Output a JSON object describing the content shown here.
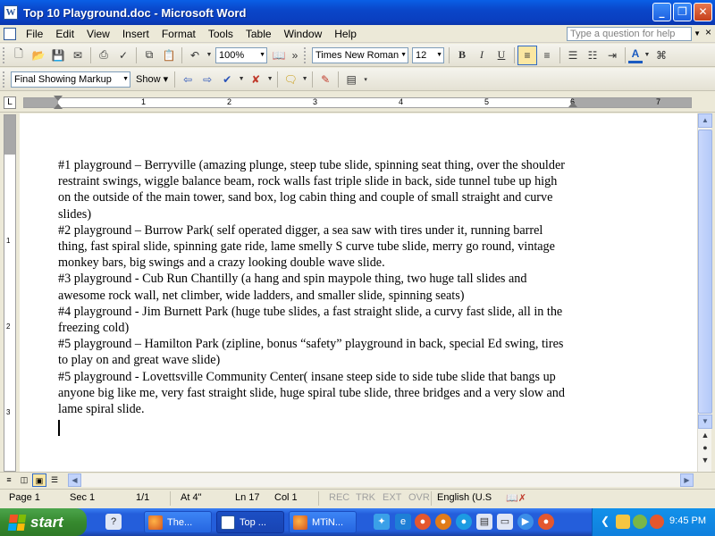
{
  "window": {
    "title": "Top 10 Playground.doc - Microsoft Word",
    "app_icon": "word-doc-icon",
    "buttons": {
      "minimize": "_",
      "restore": "❐",
      "close": "✕"
    }
  },
  "menubar": {
    "items": [
      "File",
      "Edit",
      "View",
      "Insert",
      "Format",
      "Tools",
      "Table",
      "Window",
      "Help"
    ],
    "ask_placeholder": "Type a question for help",
    "close_glyph": "×"
  },
  "toolbar": {
    "zoom": "100%",
    "font_name": "Times New Roman",
    "font_size": "12",
    "bold": "B",
    "italic": "I",
    "underline": "U"
  },
  "reviewing": {
    "display_mode": "Final Showing Markup",
    "show_label": "Show"
  },
  "ruler": {
    "numbers": [
      "1",
      "2",
      "3",
      "4",
      "5",
      "6",
      "7"
    ],
    "vertical_numbers": [
      "1",
      "2",
      "3"
    ]
  },
  "document": {
    "paragraphs": [
      "#1 playground – Berryville (amazing plunge, steep tube slide, spinning seat thing, over the shoulder restraint swings, wiggle balance beam, rock walls fast triple slide in back, side tunnel tube up high on the outside of the main tower, sand box, log cabin thing and couple of small straight and curve slides)",
      "#2 playground – Burrow Park( self operated digger, a sea saw with tires under it, running barrel thing, fast spiral slide, spinning gate ride, lame smelly S curve tube slide, merry go round, vintage monkey bars, big swings and a crazy looking double wave slide.",
      "#3 playground - Cub Run Chantilly  (a hang and spin maypole thing, two huge tall slides and awesome rock wall, net climber, wide ladders, and smaller slide, spinning seats)",
      "#4 playground - Jim Burnett Park (huge tube slides, a fast straight slide, a curvy fast slide, all in the freezing cold)",
      "#5 playground – Hamilton Park (zipline, bonus “safety” playground in back, special Ed swing, tires to play on and great wave slide)",
      "#5 playground - Lovettsville Community Center( insane steep side to side tube slide that bangs up anyone big like me, very fast straight slide, huge spiral tube slide, three bridges and a very slow and lame spiral slide."
    ]
  },
  "statusbar": {
    "page": "Page  1",
    "sec": "Sec  1",
    "pages": "1/1",
    "at": "At  4\"",
    "ln": "Ln  17",
    "col": "Col  1",
    "rec": "REC",
    "trk": "TRK",
    "ext": "EXT",
    "ovr": "OVR",
    "language": "English (U.S"
  },
  "taskbar": {
    "start_label": "start",
    "tasks": [
      {
        "label": "The...",
        "icon": "firefox-icon"
      },
      {
        "label": "Top ...",
        "icon": "word-icon"
      },
      {
        "label": "MTiN...",
        "icon": "firefox-icon"
      }
    ],
    "clock": "9:45 PM"
  },
  "colors": {
    "titlebar": "#0a46c9",
    "taskbar": "#245edb",
    "start_button": "#36892e",
    "tray": "#0f80dd"
  }
}
